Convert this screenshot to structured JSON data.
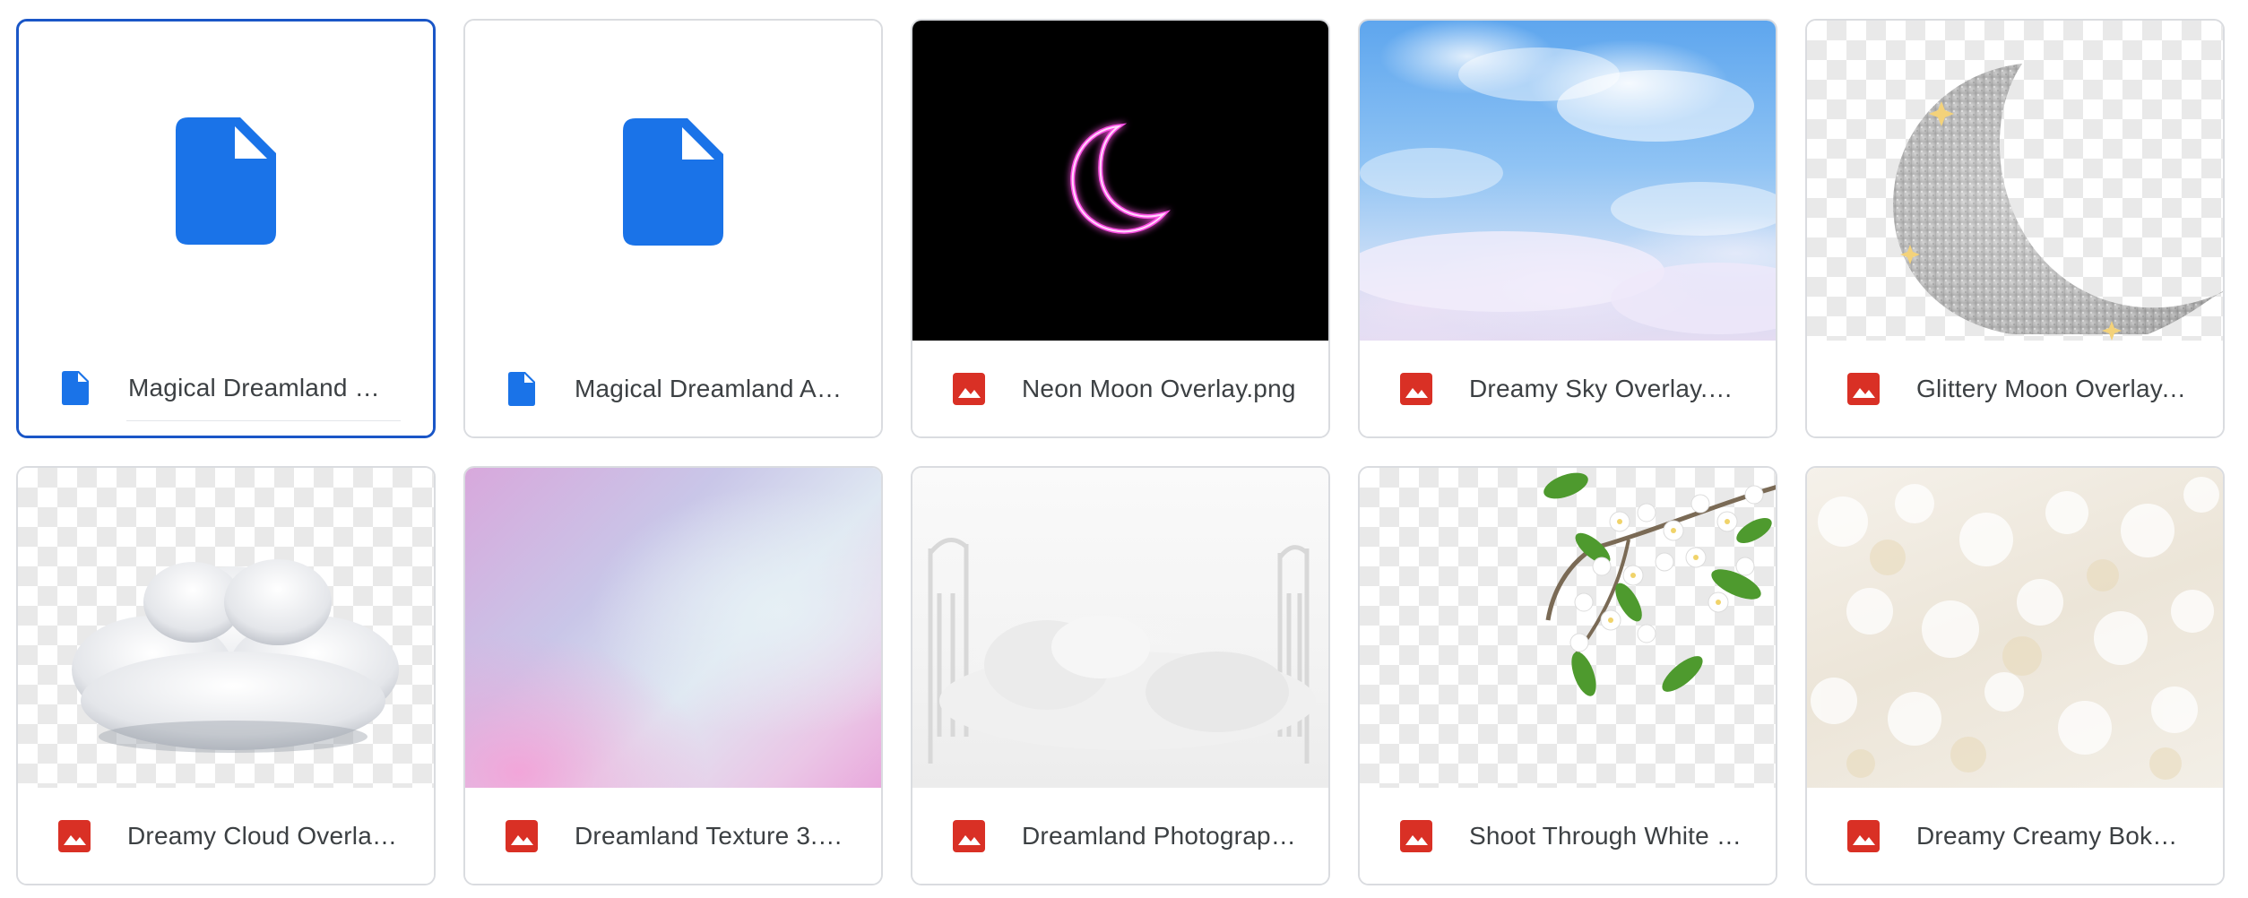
{
  "colors": {
    "doc_blue": "#1a73e8",
    "image_red": "#d93025",
    "selected_border": "#1a56c7",
    "card_border": "#dadce0",
    "text": "#3c4043"
  },
  "files": [
    {
      "name": "Magical Dreamland M…",
      "icon": "google-docs-icon",
      "thumbnail": "document-icon",
      "selected": true
    },
    {
      "name": "Magical Dreamland Ac…",
      "icon": "google-docs-icon",
      "thumbnail": "document-icon",
      "selected": false
    },
    {
      "name": "Neon Moon Overlay.png",
      "icon": "image-icon",
      "thumbnail": "neon-moon",
      "selected": false
    },
    {
      "name": "Dreamy Sky Overlay.png",
      "icon": "image-icon",
      "thumbnail": "dreamy-sky",
      "selected": false
    },
    {
      "name": "Glittery Moon Overlay.…",
      "icon": "image-icon",
      "thumbnail": "glittery-moon",
      "selected": false
    },
    {
      "name": "Dreamy Cloud Overlay.…",
      "icon": "image-icon",
      "thumbnail": "cloud",
      "selected": false
    },
    {
      "name": "Dreamland Texture 3.p…",
      "icon": "image-icon",
      "thumbnail": "pastel-texture",
      "selected": false
    },
    {
      "name": "Dreamland Photograp…",
      "icon": "image-icon",
      "thumbnail": "white-bed",
      "selected": false
    },
    {
      "name": "Shoot Through White B…",
      "icon": "image-icon",
      "thumbnail": "white-blossoms",
      "selected": false
    },
    {
      "name": "Dreamy Creamy Bokeh…",
      "icon": "image-icon",
      "thumbnail": "bokeh",
      "selected": false
    }
  ]
}
